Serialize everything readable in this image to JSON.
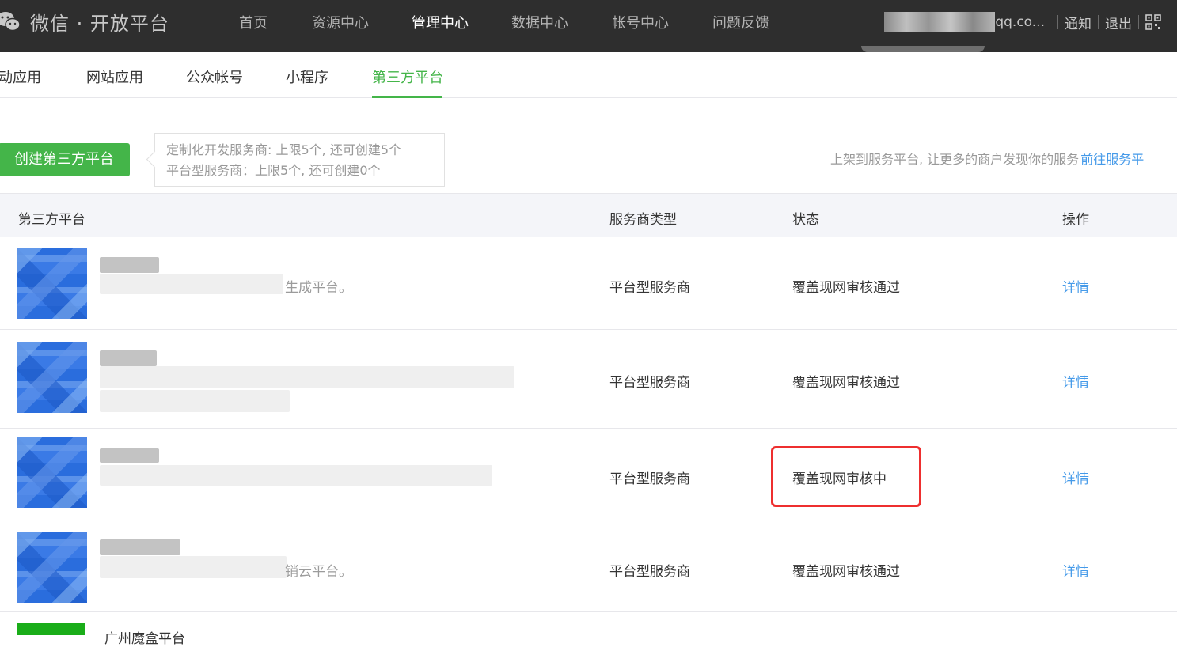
{
  "header": {
    "logo_text": "微信 · 开放平台",
    "nav": [
      "首页",
      "资源中心",
      "管理中心",
      "数据中心",
      "帐号中心",
      "问题反馈"
    ],
    "active_nav": "管理中心",
    "account_suffix": "qq.co...",
    "notify_label": "通知",
    "logout_label": "退出"
  },
  "subtabs": {
    "items": [
      "动应用",
      "网站应用",
      "公众帐号",
      "小程序",
      "第三方平台"
    ],
    "active": "第三方平台"
  },
  "toolbar": {
    "create_label": "创建第三方平台",
    "tip_line1": "定制化开发服务商: 上限5个, 还可创建5个",
    "tip_line2": "平台型服务商：上限5个, 还可创建0个",
    "promo_text": "上架到服务平台, 让更多的商户发现你的服务",
    "promo_link": "前往服务平"
  },
  "table": {
    "headers": [
      "第三方平台",
      "服务商类型",
      "状态",
      "操作"
    ],
    "rows": [
      {
        "desc_fragment": "生成平台。",
        "type": "平台型服务商",
        "status": "覆盖现网审核通过",
        "action": "详情"
      },
      {
        "desc_fragment": "",
        "type": "平台型服务商",
        "status": "覆盖现网审核通过",
        "action": "详情"
      },
      {
        "desc_fragment": "",
        "type": "平台型服务商",
        "status": "覆盖现网审核中",
        "action": "详情"
      },
      {
        "desc_fragment": "销云平台。",
        "type": "平台型服务商",
        "status": "覆盖现网审核通过",
        "action": "详情"
      }
    ],
    "partial_row_name": "广州魔盒平台"
  },
  "colors": {
    "accent_green": "#44b549",
    "link_blue": "#459ae9",
    "highlight_red": "#ee2f2f",
    "topbar": "#2e2e2e"
  }
}
